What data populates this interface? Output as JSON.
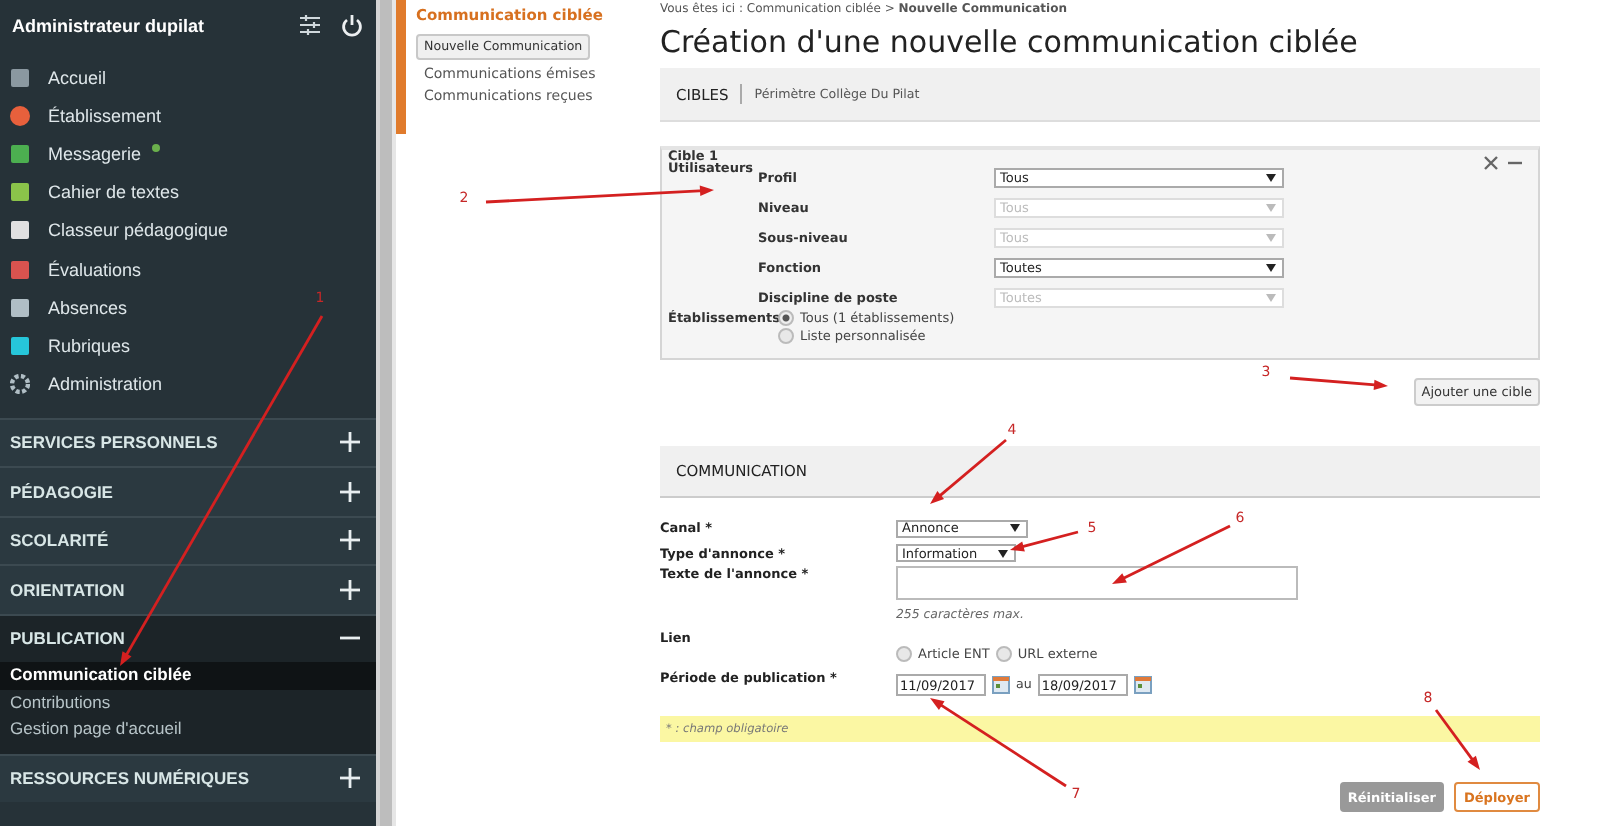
{
  "sidebar": {
    "user": "Administrateur dupilat",
    "items": [
      {
        "label": "Accueil",
        "notification": false
      },
      {
        "label": "Établissement",
        "notification": false
      },
      {
        "label": "Messagerie",
        "notification": true
      },
      {
        "label": "Cahier de textes",
        "notification": false
      },
      {
        "label": "Classeur pédagogique",
        "notification": false
      },
      {
        "label": "Évaluations",
        "notification": false
      },
      {
        "label": "Absences",
        "notification": false
      },
      {
        "label": "Rubriques",
        "notification": false
      },
      {
        "label": "Administration",
        "notification": false
      }
    ],
    "sections": [
      {
        "label": "SERVICES PERSONNELS",
        "expanded": false
      },
      {
        "label": "PÉDAGOGIE",
        "expanded": false
      },
      {
        "label": "SCOLARITÉ",
        "expanded": false
      },
      {
        "label": "ORIENTATION",
        "expanded": false
      },
      {
        "label": "PUBLICATION",
        "expanded": true,
        "children": [
          {
            "label": "Communication ciblée",
            "selected": true
          },
          {
            "label": "Contributions",
            "selected": false
          },
          {
            "label": "Gestion page d'accueil",
            "selected": false
          }
        ]
      },
      {
        "label": "RESSOURCES NUMÉRIQUES",
        "expanded": false
      }
    ]
  },
  "submenu": {
    "title": "Communication ciblée",
    "button": "Nouvelle Communication",
    "links": [
      "Communications émises",
      "Communications reçues"
    ]
  },
  "breadcrumb": "Vous êtes ici : Communication ciblée > **Nouvelle Communication**",
  "title": "Création d'une nouvelle communication ciblée",
  "cibles": {
    "heading": "CIBLES",
    "perimeter": "Périmètre Collège Du Pilat",
    "target": {
      "title": "Cible 1",
      "group": "Utilisateurs",
      "rows": [
        {
          "label": "Profil",
          "value": "Tous",
          "disabled": false
        },
        {
          "label": "Niveau",
          "value": "Tous",
          "disabled": true
        },
        {
          "label": "Sous-niveau",
          "value": "Tous",
          "disabled": true
        },
        {
          "label": "Fonction",
          "value": "Toutes",
          "disabled": false
        },
        {
          "label": "Discipline de poste",
          "value": "Toutes",
          "disabled": true
        }
      ],
      "establishments": {
        "label": "Établissements",
        "options": [
          {
            "label": "Tous (1 établissements)",
            "selected": true
          },
          {
            "label": "Liste personnalisée",
            "selected": false
          }
        ]
      }
    },
    "add_button": "Ajouter une cible"
  },
  "communication": {
    "heading": "COMMUNICATION",
    "canal": {
      "label": "Canal *",
      "value": "Annonce"
    },
    "type": {
      "label": "Type d'annonce *",
      "value": "Information"
    },
    "text": {
      "label": "Texte de l'annonce *",
      "hint": "255 caractères max."
    },
    "link": {
      "label": "Lien",
      "options": [
        {
          "label": "Article ENT",
          "selected": false
        },
        {
          "label": "URL externe",
          "selected": false
        }
      ]
    },
    "period": {
      "label": "Période de publication *",
      "from": "11/09/2017",
      "separator": "au",
      "to": "18/09/2017"
    },
    "note": "* : champ obligatoire",
    "buttons": [
      {
        "label": "Réinitialiser",
        "kind": "secondary"
      },
      {
        "label": "Déployer",
        "kind": "primary"
      }
    ]
  },
  "annotations": [
    {
      "label": "1"
    },
    {
      "label": "2"
    },
    {
      "label": "3"
    },
    {
      "label": "4"
    },
    {
      "label": "5"
    },
    {
      "label": "6"
    },
    {
      "label": "7"
    },
    {
      "label": "8"
    }
  ]
}
